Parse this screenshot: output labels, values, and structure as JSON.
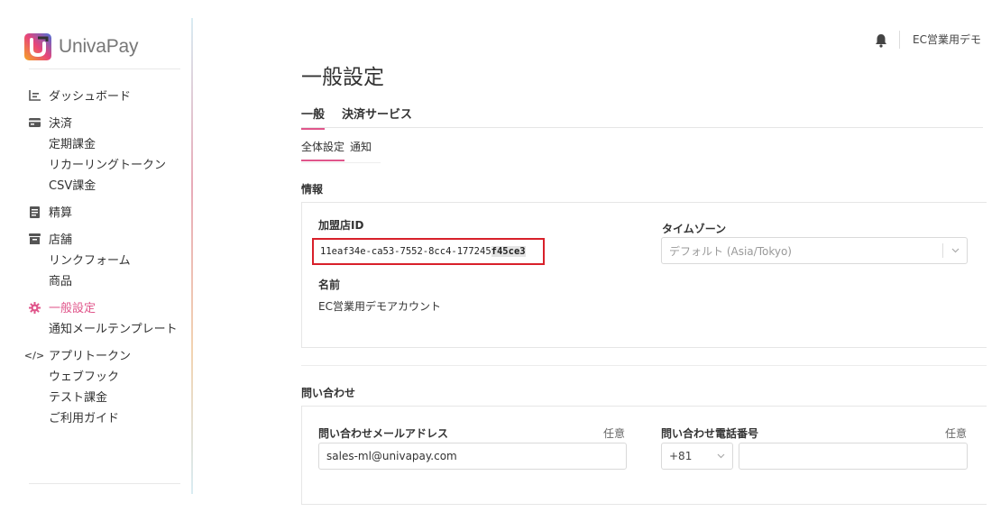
{
  "brand": {
    "name": "UnivaPay"
  },
  "sidebar": {
    "groups": [
      {
        "icon": "chart-icon",
        "items": [
          "ダッシュボード"
        ]
      },
      {
        "icon": "credit-card-icon",
        "items": [
          "決済",
          "定期課金",
          "リカーリングトークン",
          "CSV課金"
        ]
      },
      {
        "icon": "document-icon",
        "items": [
          "精算"
        ]
      },
      {
        "icon": "store-icon",
        "items": [
          "店舗",
          "リンクフォーム",
          "商品"
        ]
      },
      {
        "icon": "gear-icon",
        "items": [
          "一般設定",
          "通知メールテンプレート"
        ]
      },
      {
        "icon": "code-icon",
        "items": [
          "アプリトークン",
          "ウェブフック",
          "テスト課金",
          "ご利用ガイド"
        ]
      }
    ],
    "active": "一般設定"
  },
  "topbar": {
    "user": "EC営業用デモ"
  },
  "page": {
    "title": "一般設定",
    "tabs": [
      "一般",
      "決済サービス"
    ],
    "subtabs": [
      "全体設定",
      "通知"
    ]
  },
  "info": {
    "section_title": "情報",
    "merchant_id_label": "加盟店ID",
    "merchant_id_prefix": "11eaf34e-ca53-7552-8cc4-177245",
    "merchant_id_suffix": "f45ce3",
    "timezone_label": "タイムゾーン",
    "timezone_value": "デフォルト (Asia/Tokyo)",
    "name_label": "名前",
    "name_value": "EC営業用デモアカウント"
  },
  "contact": {
    "section_title": "問い合わせ",
    "email_label": "問い合わせメールアドレス",
    "email_optional": "任意",
    "email_value": "sales-ml@univapay.com",
    "phone_label": "問い合わせ電話番号",
    "phone_optional": "任意",
    "phone_code": "+81",
    "phone_value": ""
  },
  "colors": {
    "accent": "#e0568b",
    "highlight_border": "#d8202a"
  }
}
